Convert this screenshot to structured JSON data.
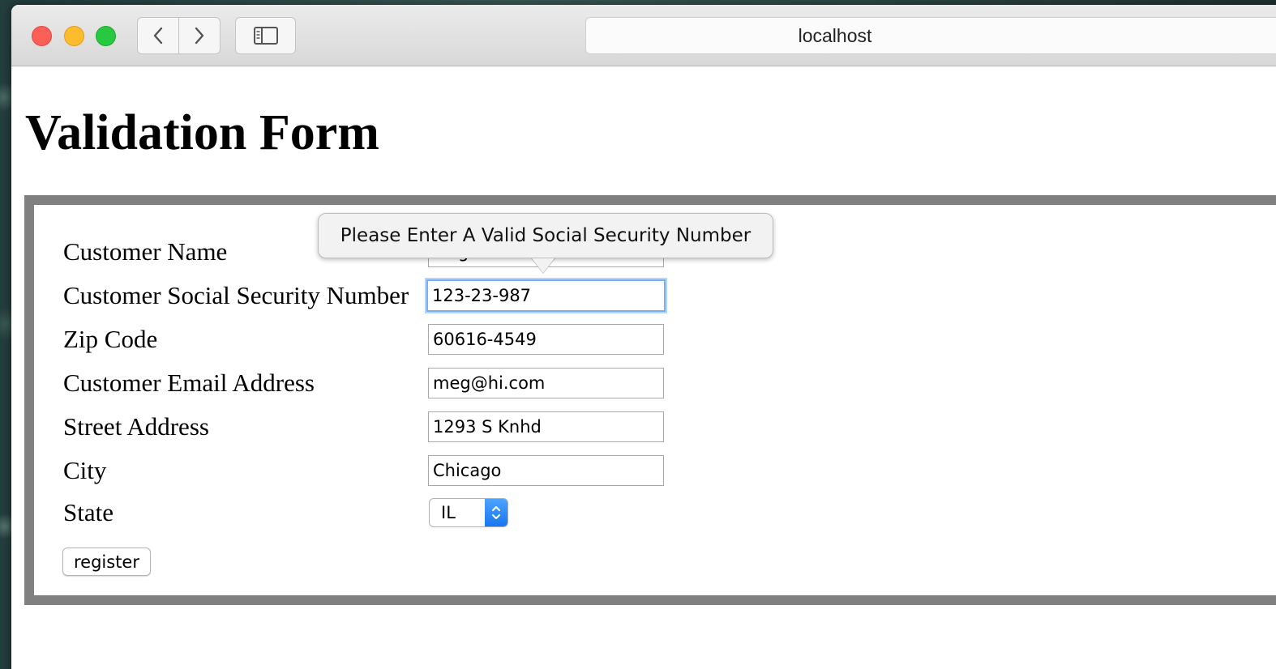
{
  "browser": {
    "address": "localhost"
  },
  "page": {
    "title": "Validation Form"
  },
  "form": {
    "tooltip": "Please Enter A Valid Social Security Number",
    "fields": [
      {
        "label": "Customer Name",
        "value": "Meghan Th"
      },
      {
        "label": "Customer Social Security Number",
        "value": "123-23-987"
      },
      {
        "label": "Zip Code",
        "value": "60616-4549"
      },
      {
        "label": "Customer Email Address",
        "value": "meg@hi.com"
      },
      {
        "label": "Street Address",
        "value": "1293 S Knhd"
      },
      {
        "label": "City",
        "value": "Chicago"
      }
    ],
    "state": {
      "label": "State",
      "value": "IL"
    },
    "register_label": "register"
  },
  "icons": {
    "back": "chevron-left-icon",
    "forward": "chevron-right-icon",
    "sidebar": "sidebar-icon",
    "select_arrows": "updown-chevron-icon"
  },
  "colors": {
    "form_border": "#808080",
    "focus_ring": "#7aaef3",
    "select_accent": "#1876f2"
  }
}
